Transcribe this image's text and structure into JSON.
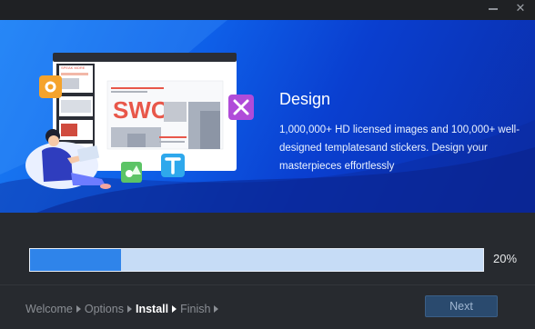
{
  "window": {
    "minimize_icon": "minimize-icon",
    "close_icon": "close-icon",
    "close_glyph": "✕"
  },
  "banner": {
    "title": "Design",
    "description": "1,000,000+ HD licensed images and 100,000+ well-designed templatesand stickers. Design your masterpieces effortlessly",
    "illustration": {
      "slide_heading": "SWOT",
      "side_panel_title": "SPEAK MORE"
    },
    "colors": {
      "gradient_start": "#1b7ef4",
      "gradient_end": "#0b2da8"
    }
  },
  "progress": {
    "value": 0.2,
    "label": "20%"
  },
  "steps": [
    {
      "label": "Welcome",
      "active": false
    },
    {
      "label": "Options",
      "active": false
    },
    {
      "label": "Install",
      "active": true
    },
    {
      "label": "Finish",
      "active": false
    }
  ],
  "footer": {
    "next_label": "Next"
  }
}
